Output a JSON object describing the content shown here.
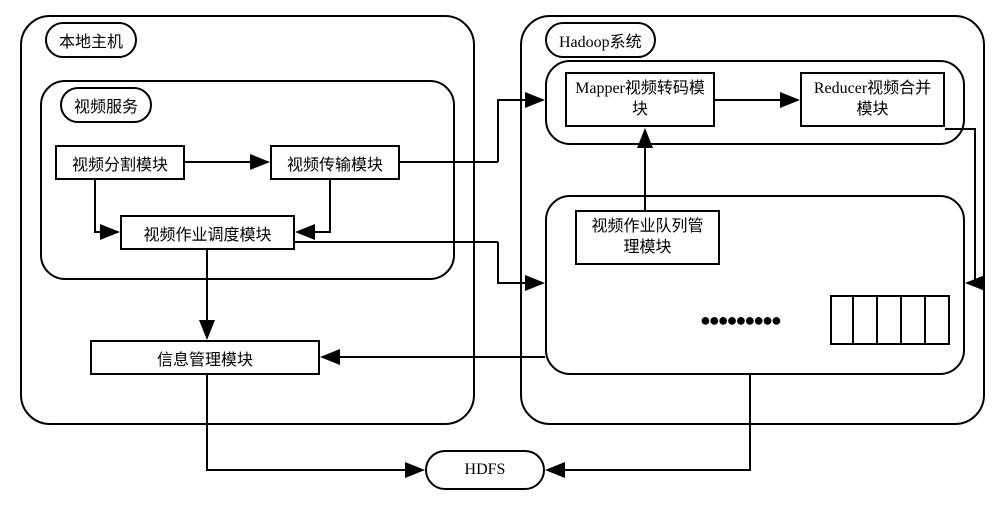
{
  "diagram": {
    "local_host_label": "本地主机",
    "video_service_label": "视频服务",
    "hadoop_label": "Hadoop系统",
    "modules": {
      "video_split": "视频分割模块",
      "video_transfer": "视频传输模块",
      "video_schedule": "视频作业调度模块",
      "info_manage": "信息管理模块",
      "mapper": "Mapper视频转码模块",
      "reducer": "Reducer视频合并模块",
      "queue_manage": "视频作业队列管理模块"
    },
    "hdfs": "HDFS"
  }
}
